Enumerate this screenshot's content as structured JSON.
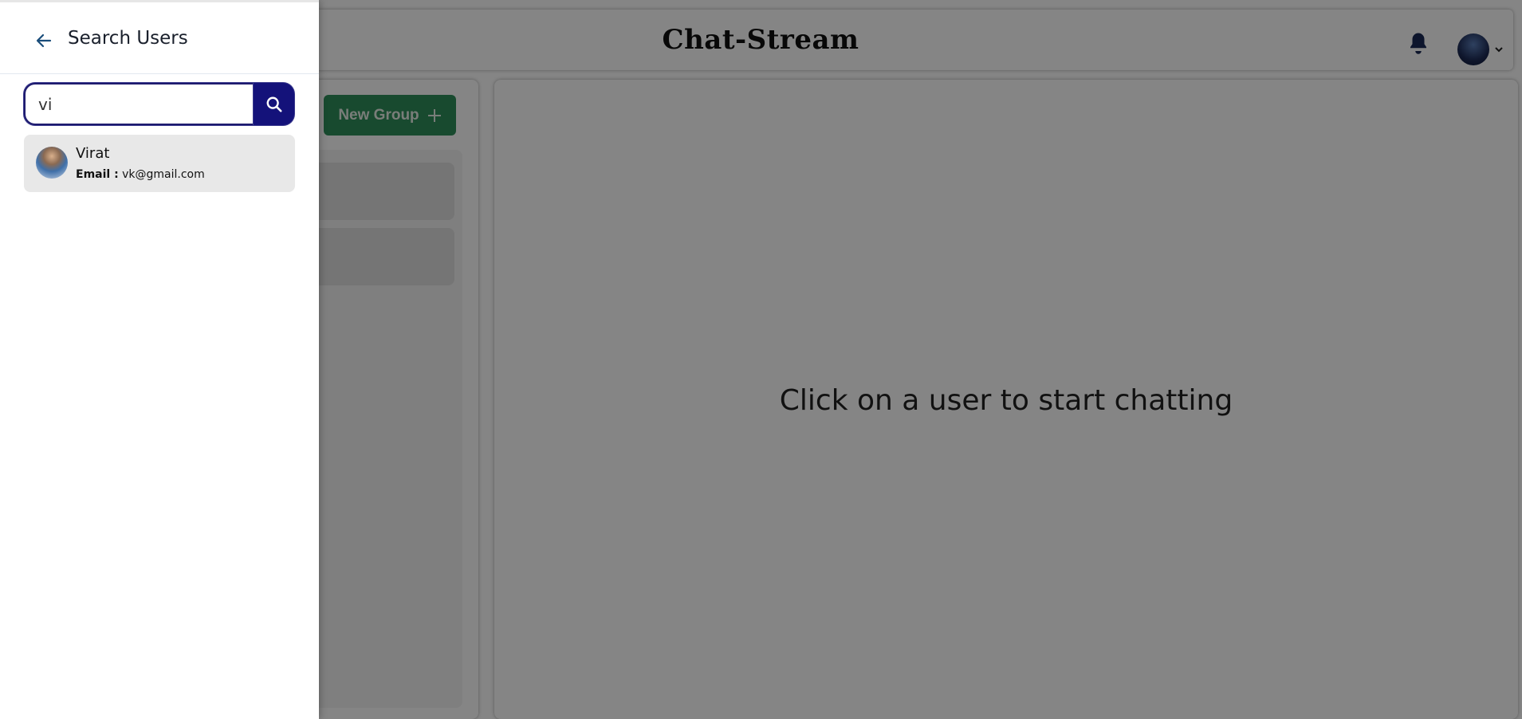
{
  "app": {
    "title": "Chat-Stream",
    "new_group_label": "New Group",
    "placeholder_message": "Click on a user to start chatting"
  },
  "drawer": {
    "title": "Search Users",
    "search_value": "vi",
    "results": [
      {
        "name": "Virat",
        "email_label": "Email :",
        "email": "vk@gmail.com"
      }
    ]
  },
  "icons": {
    "back": "arrow-left-icon",
    "search": "search-icon",
    "notifications": "bell-icon",
    "add": "plus-icon",
    "dropdown": "chevron-down-icon"
  },
  "colors": {
    "search_button": "#14127a",
    "new_group_button": "#2f8f5a",
    "overlay": "rgba(0,0,0,0.48)"
  }
}
